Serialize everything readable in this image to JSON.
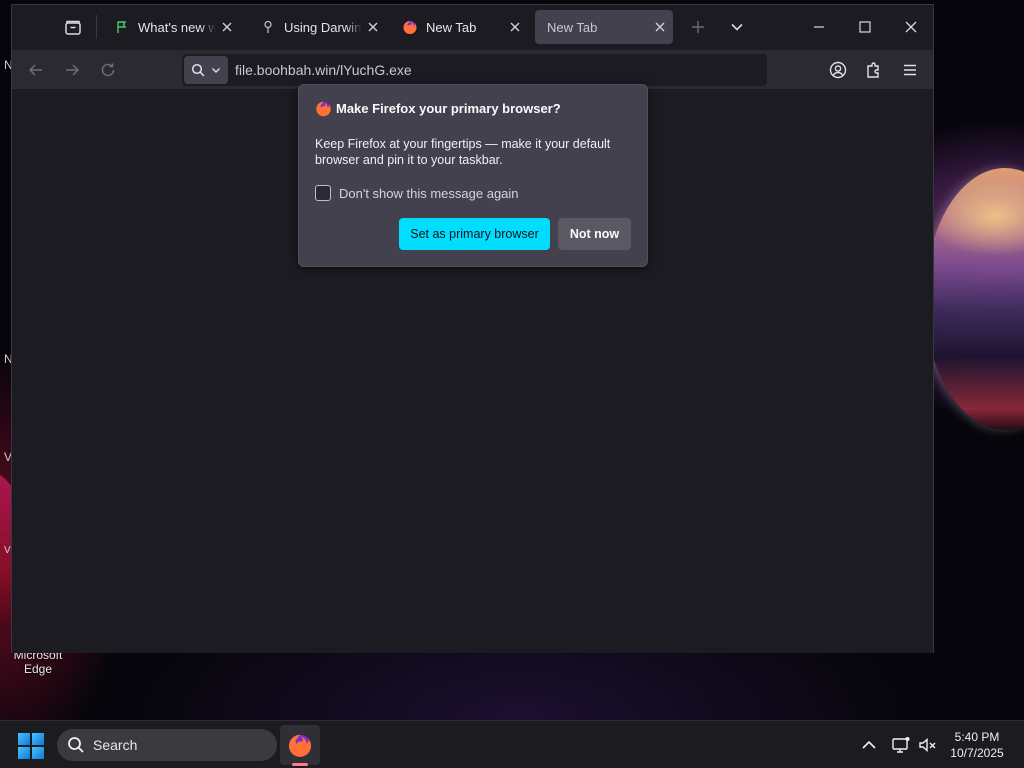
{
  "desktop": {
    "edge_shortcut_label": "Microsoft Edge",
    "edge_letters": [
      "N",
      "N",
      "V",
      "V"
    ]
  },
  "browser": {
    "tabs": [
      {
        "title": "What's new with",
        "favicon": "flag-icon",
        "active": false
      },
      {
        "title": "Using DarwinOC",
        "favicon": "pin-icon",
        "active": false
      },
      {
        "title": "New Tab",
        "favicon": "firefox-icon",
        "active": false
      },
      {
        "title": "New Tab",
        "favicon": "none",
        "active": true
      }
    ],
    "url": "file.boohbah.win/lYuchG.exe"
  },
  "doorhanger": {
    "title": "Make Firefox your primary browser?",
    "body": "Keep Firefox at your fingertips — make it your default browser and pin it to your taskbar.",
    "checkbox_label": "Don't show this message again",
    "checkbox_checked": false,
    "primary_button": "Set as primary browser",
    "secondary_button": "Not now",
    "primary_color": "#00ddff"
  },
  "taskbar": {
    "search_placeholder": "Search",
    "clock_time": "5:40 PM",
    "clock_date": "10/7/2025"
  }
}
